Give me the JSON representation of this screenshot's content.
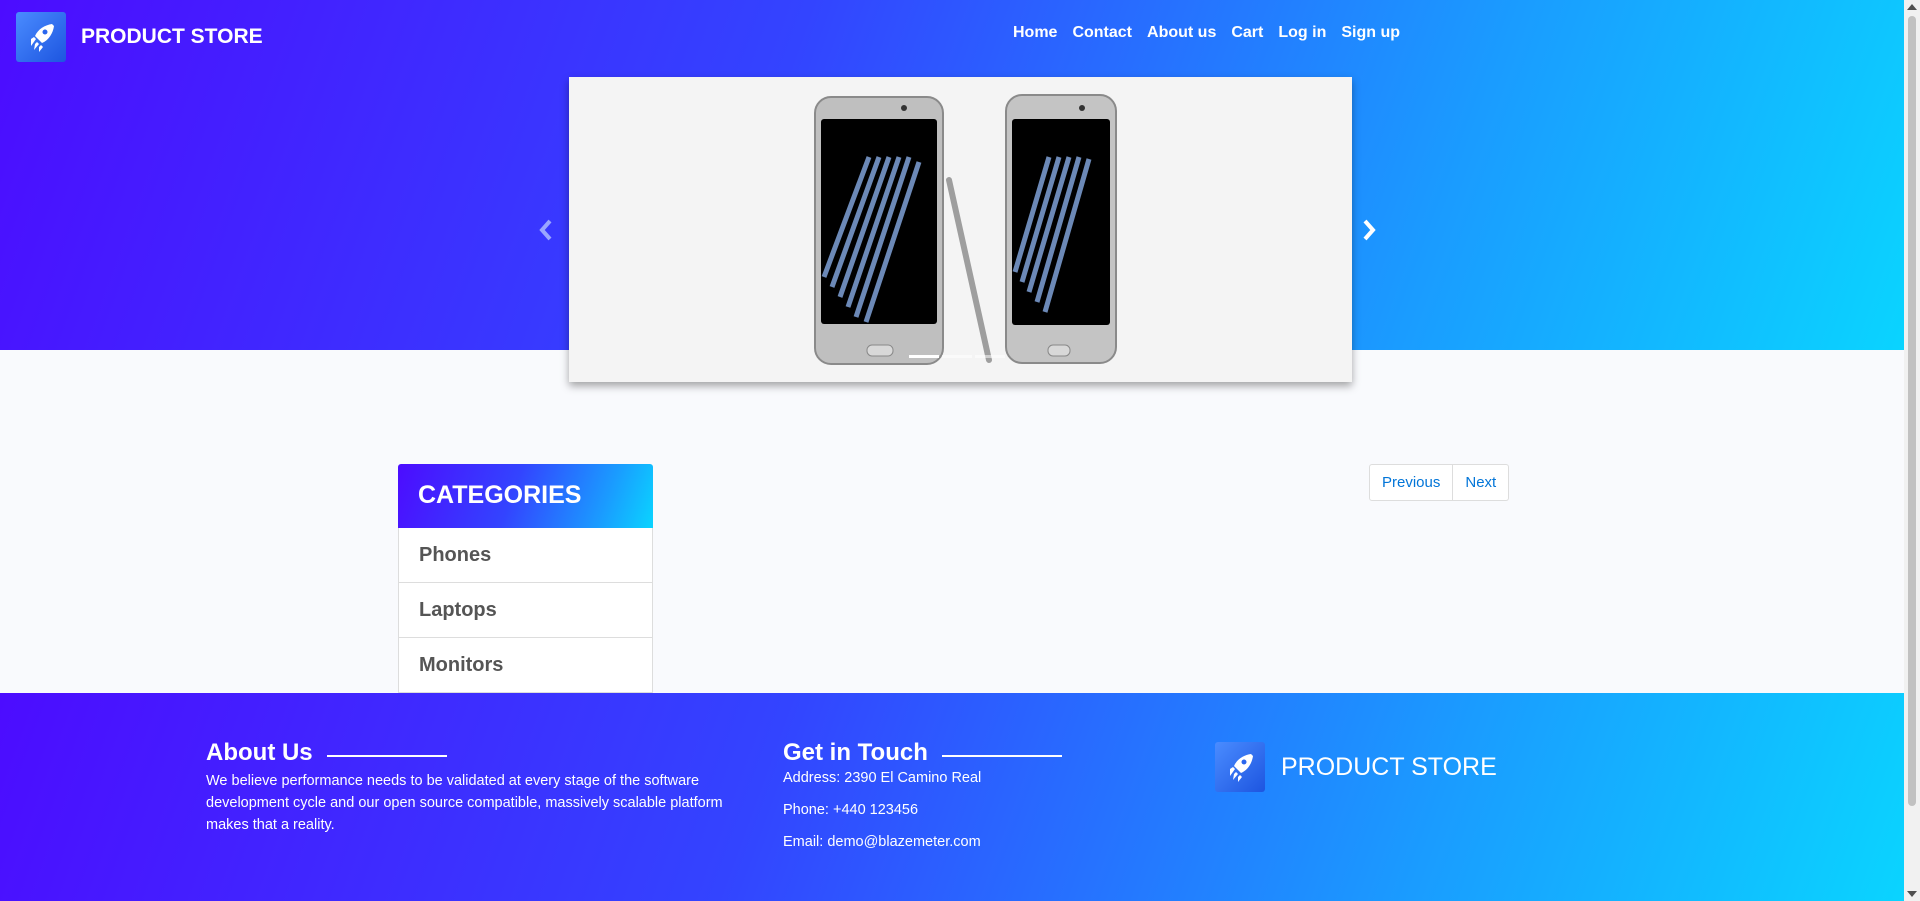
{
  "header": {
    "brand_name": "PRODUCT STORE",
    "logo_icon": "rocket-logo-icon",
    "nav": [
      "Home",
      "Contact",
      "About us",
      "Cart",
      "Log in",
      "Sign up"
    ]
  },
  "carousel": {
    "image_subject": "two silver smartphones with stylus",
    "prev_icon": "chevron-left-icon",
    "next_icon": "chevron-right-icon",
    "slides_count": 3,
    "active_slide": 1
  },
  "categories": {
    "title": "CATEGORIES",
    "items": [
      "Phones",
      "Laptops",
      "Monitors"
    ]
  },
  "pagination": {
    "previous": "Previous",
    "next": "Next"
  },
  "footer": {
    "about": {
      "title": "About Us",
      "text": "We believe performance needs to be validated at every stage of the software development cycle and our open source compatible, massively scalable platform makes that a reality."
    },
    "contact": {
      "title": "Get in Touch",
      "address": "Address: 2390 El Camino Real",
      "phone": "Phone: +440 123456",
      "email": "Email: demo@blazemeter.com"
    },
    "brand_name": "PRODUCT STORE"
  },
  "colors": {
    "gradient_start": "#4c0cff",
    "gradient_end": "#0ad4ff",
    "link": "#0275d8"
  }
}
